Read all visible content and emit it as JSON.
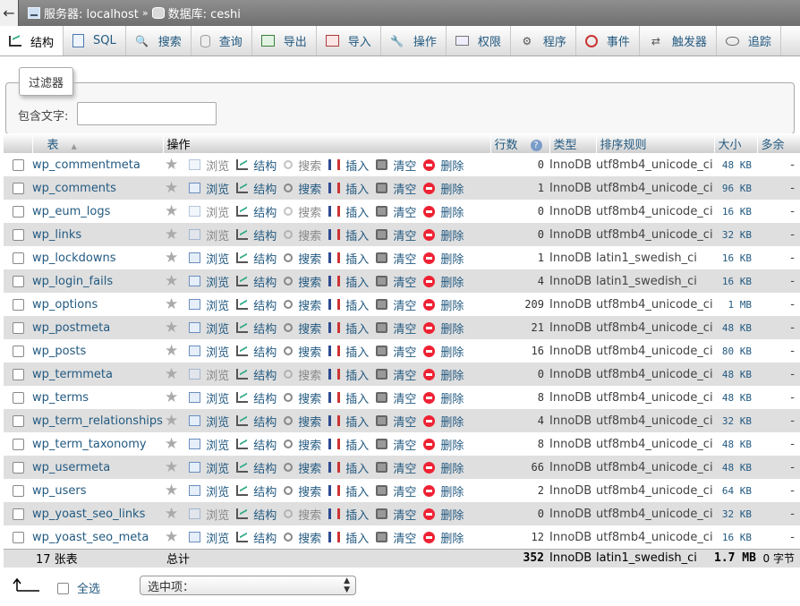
{
  "breadcrumb": {
    "back_glyph": "←",
    "server_label": "服务器: localhost",
    "separator": "»",
    "database_label": "数据库: ceshi"
  },
  "tabs": [
    {
      "label": "结构",
      "icon": "structure-icon",
      "active": true
    },
    {
      "label": "SQL",
      "icon": "sql-icon"
    },
    {
      "label": "搜索",
      "icon": "search-icon"
    },
    {
      "label": "查询",
      "icon": "query-icon"
    },
    {
      "label": "导出",
      "icon": "export-icon"
    },
    {
      "label": "导入",
      "icon": "import-icon"
    },
    {
      "label": "操作",
      "icon": "wrench-icon"
    },
    {
      "label": "权限",
      "icon": "privileges-icon"
    },
    {
      "label": "程序",
      "icon": "routines-icon"
    },
    {
      "label": "事件",
      "icon": "events-icon"
    },
    {
      "label": "触发器",
      "icon": "triggers-icon"
    },
    {
      "label": "追踪",
      "icon": "tracking-icon"
    }
  ],
  "filter": {
    "legend": "过滤器",
    "label": "包含文字:",
    "value": ""
  },
  "table": {
    "headers": {
      "table": "表",
      "sort_glyph": "▲",
      "action": "操作",
      "rows": "行数",
      "type": "类型",
      "collation": "排序规则",
      "size": "大小",
      "overhead": "多余"
    },
    "action_labels": {
      "browse": "浏览",
      "structure": "结构",
      "search": "搜索",
      "insert": "插入",
      "empty": "清空",
      "drop": "删除"
    },
    "rows": [
      {
        "name": "wp_commentmeta",
        "rows": "0",
        "type": "InnoDB",
        "collation": "utf8mb4_unicode_ci",
        "size": "48 KB",
        "overhead": "-",
        "empty": true
      },
      {
        "name": "wp_comments",
        "rows": "1",
        "type": "InnoDB",
        "collation": "utf8mb4_unicode_ci",
        "size": "96 KB",
        "overhead": "-",
        "empty": false
      },
      {
        "name": "wp_eum_logs",
        "rows": "0",
        "type": "InnoDB",
        "collation": "utf8mb4_unicode_ci",
        "size": "16 KB",
        "overhead": "-",
        "empty": true
      },
      {
        "name": "wp_links",
        "rows": "0",
        "type": "InnoDB",
        "collation": "utf8mb4_unicode_ci",
        "size": "32 KB",
        "overhead": "-",
        "empty": true
      },
      {
        "name": "wp_lockdowns",
        "rows": "1",
        "type": "InnoDB",
        "collation": "latin1_swedish_ci",
        "size": "16 KB",
        "overhead": "-",
        "empty": false
      },
      {
        "name": "wp_login_fails",
        "rows": "4",
        "type": "InnoDB",
        "collation": "latin1_swedish_ci",
        "size": "16 KB",
        "overhead": "-",
        "empty": false
      },
      {
        "name": "wp_options",
        "rows": "209",
        "type": "InnoDB",
        "collation": "utf8mb4_unicode_ci",
        "size": "1 MB",
        "overhead": "-",
        "empty": false
      },
      {
        "name": "wp_postmeta",
        "rows": "21",
        "type": "InnoDB",
        "collation": "utf8mb4_unicode_ci",
        "size": "48 KB",
        "overhead": "-",
        "empty": false
      },
      {
        "name": "wp_posts",
        "rows": "16",
        "type": "InnoDB",
        "collation": "utf8mb4_unicode_ci",
        "size": "80 KB",
        "overhead": "-",
        "empty": false
      },
      {
        "name": "wp_termmeta",
        "rows": "0",
        "type": "InnoDB",
        "collation": "utf8mb4_unicode_ci",
        "size": "48 KB",
        "overhead": "-",
        "empty": true
      },
      {
        "name": "wp_terms",
        "rows": "8",
        "type": "InnoDB",
        "collation": "utf8mb4_unicode_ci",
        "size": "48 KB",
        "overhead": "-",
        "empty": false
      },
      {
        "name": "wp_term_relationships",
        "rows": "4",
        "type": "InnoDB",
        "collation": "utf8mb4_unicode_ci",
        "size": "32 KB",
        "overhead": "-",
        "empty": false
      },
      {
        "name": "wp_term_taxonomy",
        "rows": "8",
        "type": "InnoDB",
        "collation": "utf8mb4_unicode_ci",
        "size": "48 KB",
        "overhead": "-",
        "empty": false
      },
      {
        "name": "wp_usermeta",
        "rows": "66",
        "type": "InnoDB",
        "collation": "utf8mb4_unicode_ci",
        "size": "48 KB",
        "overhead": "-",
        "empty": false
      },
      {
        "name": "wp_users",
        "rows": "2",
        "type": "InnoDB",
        "collation": "utf8mb4_unicode_ci",
        "size": "64 KB",
        "overhead": "-",
        "empty": false
      },
      {
        "name": "wp_yoast_seo_links",
        "rows": "0",
        "type": "InnoDB",
        "collation": "utf8mb4_unicode_ci",
        "size": "32 KB",
        "overhead": "-",
        "empty": true
      },
      {
        "name": "wp_yoast_seo_meta",
        "rows": "12",
        "type": "InnoDB",
        "collation": "utf8mb4_unicode_ci",
        "size": "16 KB",
        "overhead": "-",
        "empty": false
      }
    ],
    "footer": {
      "count": "17 张表",
      "label": "总计",
      "rows": "352",
      "type": "InnoDB",
      "collation": "latin1_swedish_ci",
      "size": "1.7 MB",
      "overhead": "0 字节"
    }
  },
  "bottom": {
    "select_all_label": "全选",
    "bulk_select_value": "选中项："
  }
}
